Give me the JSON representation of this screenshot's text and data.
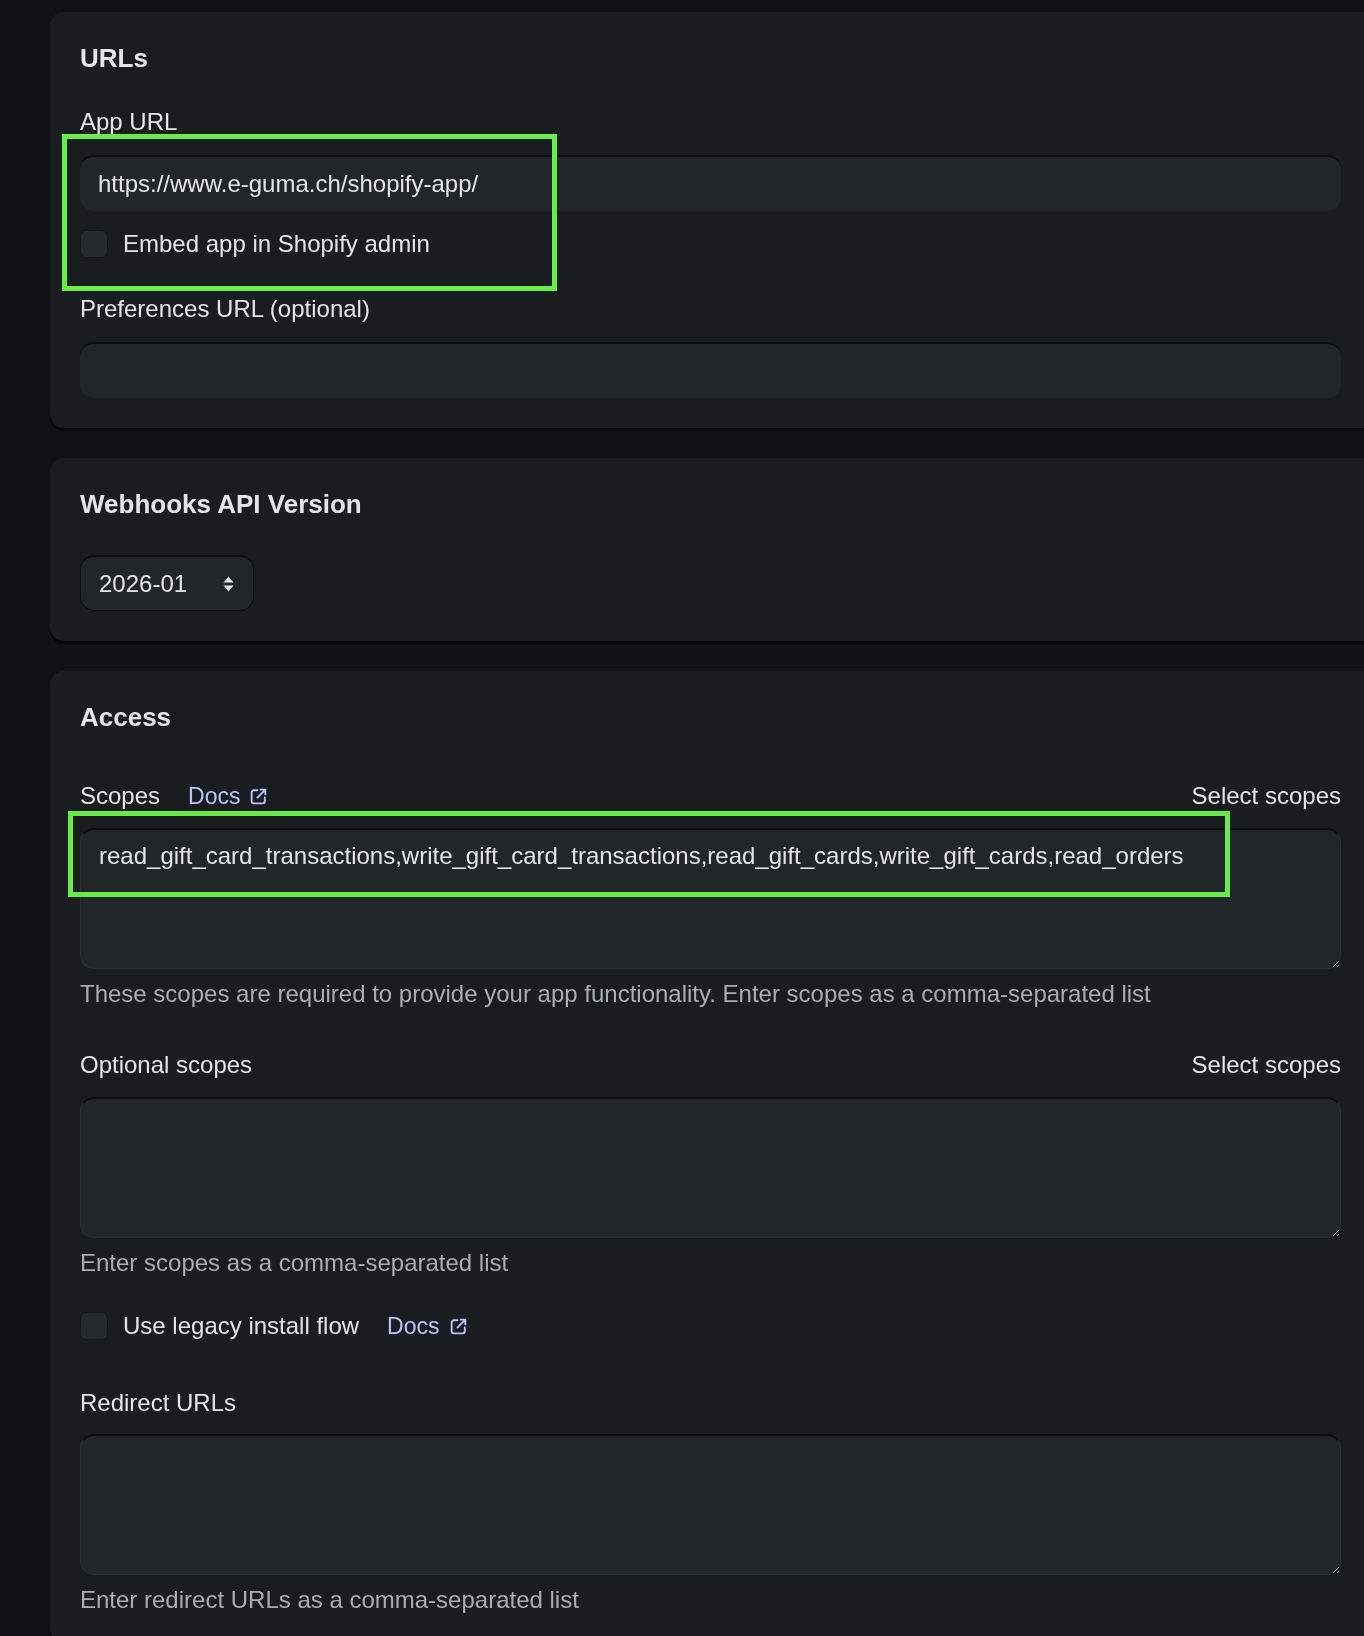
{
  "sections": [
    {
      "title": "URLs",
      "items": [
        {
          "kind": "label",
          "text": "App URL"
        },
        {
          "kind": "group",
          "highlighted": true,
          "items": [
            {
              "kind": "input",
              "value": "https://www.e-guma.ch/shopify-app/"
            },
            {
              "kind": "checkbox",
              "label": "Embed app in Shopify admin",
              "checked": false
            }
          ]
        },
        {
          "kind": "label",
          "text": "Preferences URL (optional)"
        },
        {
          "kind": "input"
        }
      ]
    },
    {
      "title": "Webhooks API Version",
      "items": [
        {
          "kind": "select",
          "value": "2026-01"
        }
      ]
    },
    {
      "title": "Access",
      "items": [
        {
          "kind": "textarea",
          "label": "Scopes",
          "link": "Docs",
          "action": "Select scopes",
          "value": "read_gift_card_transactions,write_gift_card_transactions,read_gift_cards,write_gift_cards,read_orders",
          "highlighted": true,
          "help": "These scopes are required to provide your app functionality. Enter scopes as a comma-separated list"
        },
        {
          "kind": "textarea",
          "label": "Optional scopes",
          "action": "Select scopes",
          "highlighted": false,
          "help": "Enter scopes as a comma-separated list"
        },
        {
          "kind": "checkbox",
          "label": "Use legacy install flow",
          "link": "Docs",
          "checked": false
        },
        {
          "kind": "textarea",
          "label": "Redirect URLs",
          "highlighted": false,
          "help": "Enter redirect URLs as a comma-separated list"
        }
      ]
    }
  ]
}
